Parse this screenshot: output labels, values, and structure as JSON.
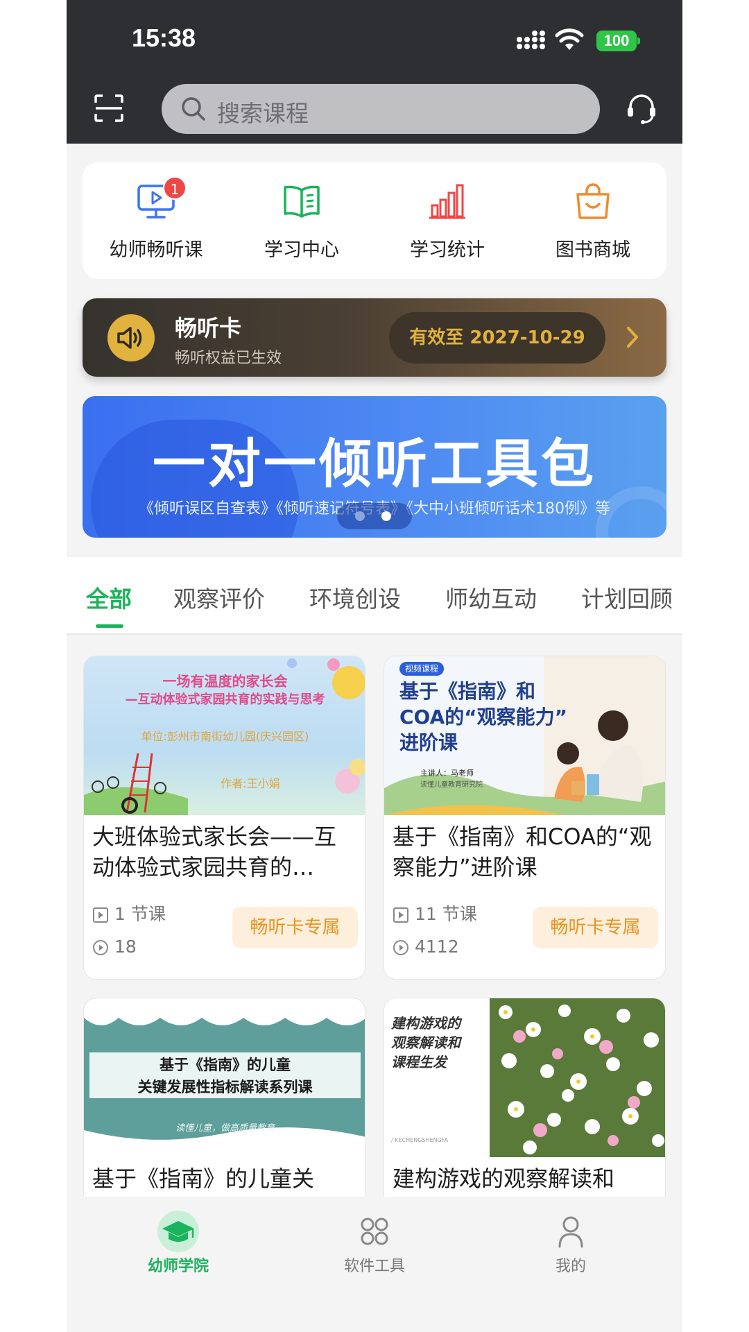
{
  "status_bar": {
    "time": "15:38",
    "battery": "100"
  },
  "header": {
    "search_placeholder": "搜索课程"
  },
  "quick_nav": [
    {
      "label": "幼师畅听课",
      "icon": "video-lesson-icon",
      "badge": "1",
      "color": "#3d74f0"
    },
    {
      "label": "学习中心",
      "icon": "book-icon",
      "color": "#19b45b"
    },
    {
      "label": "学习统计",
      "icon": "bar-chart-icon",
      "color": "#f04646"
    },
    {
      "label": "图书商城",
      "icon": "shopping-bag-icon",
      "color": "#f08a2c"
    }
  ],
  "pass_card": {
    "title": "畅听卡",
    "subtitle": "畅听权益已生效",
    "valid_until": "有效至 2027-10-29"
  },
  "banner": {
    "title": "一对一倾听工具包",
    "subtitle": "《倾听误区自查表》《倾听速记符号表》《大中小班倾听话术180例》等",
    "slides": 2,
    "active_slide": 2
  },
  "tabs": [
    "全部",
    "观察评价",
    "环境创设",
    "师幼互动",
    "计划回顾"
  ],
  "active_tab": 0,
  "courses": [
    {
      "title": "大班体验式家长会——互动体验式家园共育的…",
      "lessons": "1 节课",
      "plays": "18",
      "tag": "畅听卡专属",
      "thumb": {
        "line1": "一场有温度的家长会",
        "line2": "—互动体验式家园共育的实践与思考",
        "line3": "单位:彭州市南街幼儿园(庆兴园区)",
        "line4": "作者:王小娟"
      }
    },
    {
      "title": "基于《指南》和COA的“观察能力”进阶课",
      "lessons": "11 节课",
      "plays": "4112",
      "tag": "畅听卡专属",
      "thumb": {
        "badge": "视频课程",
        "heading": "基于《指南》和 COA的“观察能力” 进阶课",
        "speaker": "主讲人：马老师",
        "org": "读懂儿童教育研究院"
      }
    },
    {
      "title": "基于《指南》的儿童关",
      "thumb": {
        "line1": "基于《指南》的儿童",
        "line2": "关键发展性指标解读系列课",
        "line3": "读懂儿童，做高质量教育"
      }
    },
    {
      "title": "建构游戏的观察解读和",
      "thumb": {
        "heading": "建构游戏的 观察解读和 课程生发",
        "code": "/ KECHENGSHENGFA"
      }
    }
  ],
  "tabbar": [
    {
      "label": "幼师学院",
      "icon": "graduation-cap-icon",
      "active": true
    },
    {
      "label": "软件工具",
      "icon": "apps-grid-icon",
      "active": false
    },
    {
      "label": "我的",
      "icon": "user-icon",
      "active": false
    }
  ]
}
